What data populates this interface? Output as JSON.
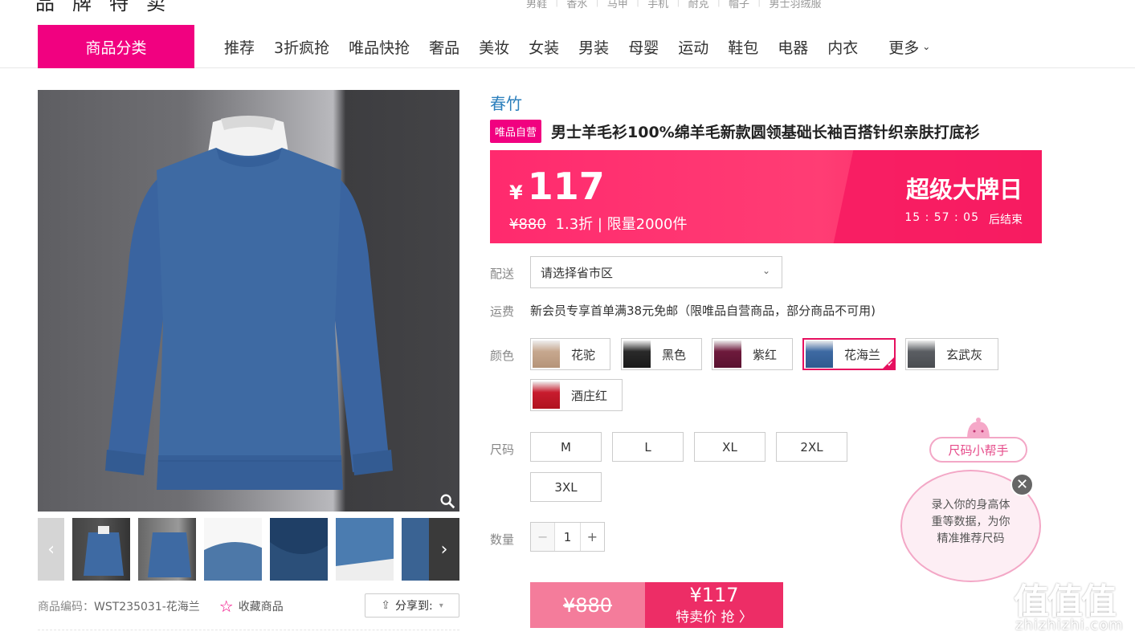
{
  "header": {
    "logo_partial": "品牌特卖",
    "keywords": [
      "男鞋",
      "香水",
      "马甲",
      "手机",
      "耐克",
      "帽子",
      "男士羽绒服"
    ]
  },
  "nav": {
    "category_button": "商品分类",
    "items": [
      "推荐",
      "3折疯抢",
      "唯品快抢",
      "奢品",
      "美妆",
      "女装",
      "男装",
      "母婴",
      "运动",
      "鞋包",
      "电器",
      "内衣"
    ],
    "more": "更多"
  },
  "gallery": {
    "product_code_label": "商品编码：",
    "product_code": "WST235031-花海兰",
    "favorite_label": "收藏商品",
    "share_label": "分享到:"
  },
  "product": {
    "brand": "春竹",
    "badge": "唯品自营",
    "title": "男士羊毛衫100%绵羊毛新款圆领基础长袖百搭针织亲肤打底衫"
  },
  "price_banner": {
    "currency": "¥",
    "price": "117",
    "original_price": "¥880",
    "discount_limit": "1.3折 | 限量2000件",
    "event": "超级大牌日",
    "countdown": "15 : 57 : 05",
    "countdown_suffix": "后结束"
  },
  "delivery": {
    "label": "配送",
    "placeholder": "请选择省市区"
  },
  "shipping": {
    "label": "运费",
    "text": "新会员专享首单满38元免邮（限唯品自营商品，部分商品不可用)"
  },
  "colors": {
    "label": "颜色",
    "options": [
      "花驼",
      "黑色",
      "紫红",
      "花海兰",
      "玄武灰",
      "酒庄红"
    ],
    "selected": "花海兰"
  },
  "sizes": {
    "label": "尺码",
    "options": [
      "M",
      "L",
      "XL",
      "2XL",
      "3XL"
    ]
  },
  "quantity": {
    "label": "数量",
    "value": "1",
    "minus": "−",
    "plus": "+"
  },
  "buy": {
    "original": "¥880",
    "price": "¥117",
    "action": "特卖价 抢 〉"
  },
  "size_helper": {
    "title": "尺码小帮手",
    "line1": "录入你的身高体",
    "line2": "重等数据，为你",
    "line3": "精准推荐尺码",
    "close": "✕"
  },
  "watermark": {
    "big": "值值值",
    "small": "zhizhizhi.com"
  },
  "colors_hex": {
    "accent": "#f10180",
    "price_banner": "#ff2a6e",
    "link_blue": "#2c7fbc",
    "sweater_blue": "#3e6aa3"
  }
}
